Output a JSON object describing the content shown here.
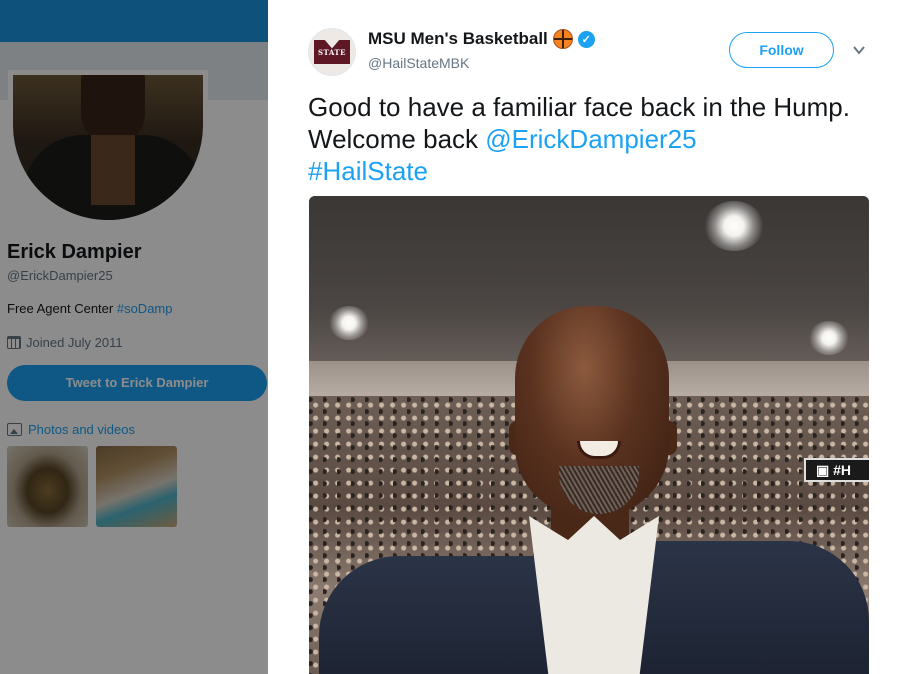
{
  "profile": {
    "name": "Erick Dampier",
    "handle": "@ErickDampier25",
    "bio_text": "Free Agent Center ",
    "bio_hashtag": "#soDamp",
    "joined": "Joined July 2011",
    "tweet_to_label": "Tweet to Erick Dampier",
    "photos_label": "Photos and videos"
  },
  "tweet": {
    "author_name": "MSU Men's Basketball",
    "author_handle": "@HailStateMBK",
    "follow_label": "Follow",
    "text_part1": "Good to have a familiar face back in the Hump. Welcome back ",
    "mention": "@ErickDampier25",
    "hashtag": "#HailState",
    "logo_text": "STATE",
    "photo_sign_text": "▣ #H"
  },
  "icons": {
    "calendar": "calendar-icon",
    "photos": "image-icon",
    "basketball": "basketball-emoji-icon",
    "verified": "verified-badge-icon",
    "more": "chevron-down-icon"
  },
  "colors": {
    "accent": "#1da1f2",
    "header": "#1b95e0",
    "text": "#14171a",
    "muted": "#657786",
    "msu_maroon": "#5d1725"
  }
}
